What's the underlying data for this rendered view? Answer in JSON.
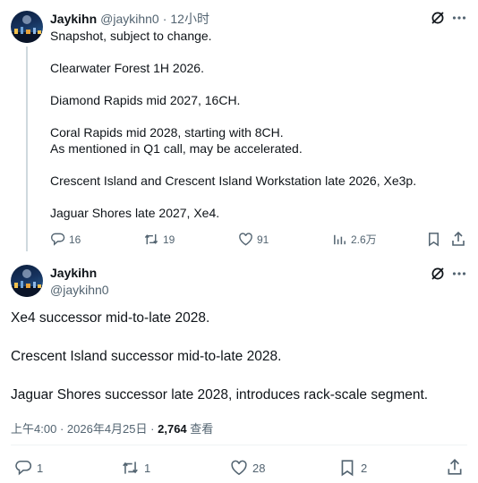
{
  "tweet1": {
    "display_name": "Jaykihn",
    "handle": "@jaykihn0",
    "separator": "·",
    "time": "12小时",
    "text": "Snapshot, subject to change.\n\nClearwater Forest 1H 2026.\n\nDiamond Rapids mid 2027, 16CH.\n\nCoral Rapids mid 2028, starting with 8CH.\nAs mentioned in Q1 call, may be accelerated.\n\nCrescent Island and Crescent Island Workstation late 2026, Xe3p.\n\nJaguar Shores late 2027, Xe4.",
    "replies": "16",
    "reposts": "19",
    "likes": "91",
    "views": "2.6万"
  },
  "tweet2": {
    "display_name": "Jaykihn",
    "handle": "@jaykihn0",
    "text": "Xe4 successor mid-to-late 2028.\n\nCrescent Island successor mid-to-late 2028.\n\nJaguar Shores successor late 2028, introduces rack-scale segment.",
    "time": "上午4:00",
    "dot": "·",
    "date": "2026年4月25日",
    "dot2": "·",
    "view_count": "2,764",
    "views_label": "查看",
    "replies": "1",
    "reposts": "1",
    "likes": "28",
    "bookmarks": "2"
  },
  "colors": {
    "text": "#0f1419",
    "secondary": "#536471",
    "thread_line": "#cfd9de"
  },
  "icons": [
    "grok-icon",
    "more-icon",
    "reply-icon",
    "repost-icon",
    "like-icon",
    "views-icon",
    "bookmark-icon",
    "share-icon"
  ]
}
